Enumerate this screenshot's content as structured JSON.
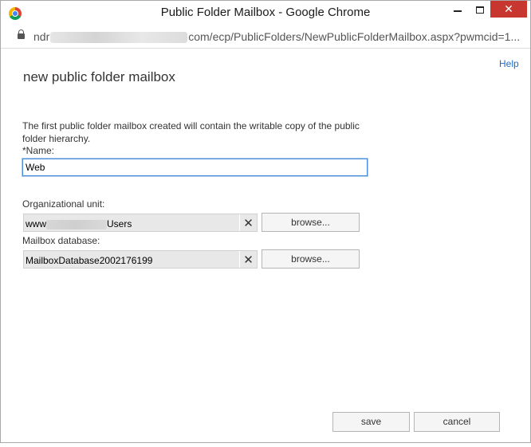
{
  "window": {
    "title": "Public Folder Mailbox - Google Chrome",
    "close_glyph": "✕"
  },
  "address_bar": {
    "url_prefix": "ndr",
    "url_path": "com/ecp/PublicFolders/NewPublicFolderMailbox.aspx?pwmcid=1..."
  },
  "page": {
    "help_label": "Help",
    "heading": "new public folder mailbox",
    "description": "The first public folder mailbox created will contain the writable copy of the public folder hierarchy."
  },
  "form": {
    "name": {
      "label": "*Name:",
      "value": "Web"
    },
    "organizational_unit": {
      "label": "Organizational unit:",
      "value_prefix": "www",
      "value_suffix": "Users",
      "clear_glyph": "✕",
      "browse_label": "browse..."
    },
    "mailbox_database": {
      "label": "Mailbox database:",
      "value": "MailboxDatabase2002176199",
      "clear_glyph": "✕",
      "browse_label": "browse..."
    }
  },
  "footer": {
    "save_label": "save",
    "cancel_label": "cancel"
  },
  "icons": {
    "app": "chrome-logo-icon",
    "lock": "lock-icon",
    "clear": "close-x-icon"
  },
  "colors": {
    "close_button": "#c7372f",
    "link": "#1e6bc5",
    "input_focus_border": "#4a90d9",
    "readonly_field_bg": "#e8e8e8"
  }
}
